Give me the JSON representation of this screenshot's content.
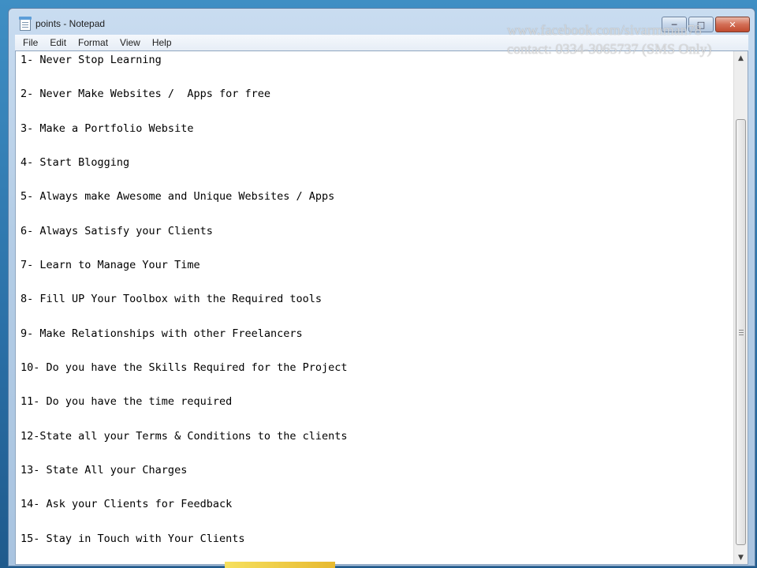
{
  "window": {
    "title": "points - Notepad"
  },
  "menu": [
    "File",
    "Edit",
    "Format",
    "View",
    "Help"
  ],
  "document": {
    "lines": [
      "1- Never Stop Learning",
      "2- Never Make Websites /  Apps for free",
      "3- Make a Portfolio Website",
      "4- Start Blogging",
      "5- Always make Awesome and Unique Websites / Apps",
      "6- Always Satisfy your Clients",
      "7- Learn to Manage Your Time",
      "8- Fill UP Your Toolbox with the Required tools",
      "9- Make Relationships with other Freelancers",
      "10- Do you have the Skills Required for the Project",
      "11- Do you have the time required",
      "12-State all your Terms & Conditions to the clients",
      "13- State All your Charges",
      "14- Ask your Clients for Feedback",
      "15- Stay in Touch with Your Clients"
    ]
  },
  "watermark": {
    "line1": "www.facebook.com/sivarmman78",
    "line2": "contact: 0334-3065737 (SMS Only)"
  },
  "icons": {
    "app": "notepad-icon",
    "minimize": "minimize-icon",
    "maximize": "maximize-icon",
    "close": "close-icon",
    "scroll_up": "scroll-up-arrow-icon",
    "scroll_down": "scroll-down-arrow-icon"
  }
}
